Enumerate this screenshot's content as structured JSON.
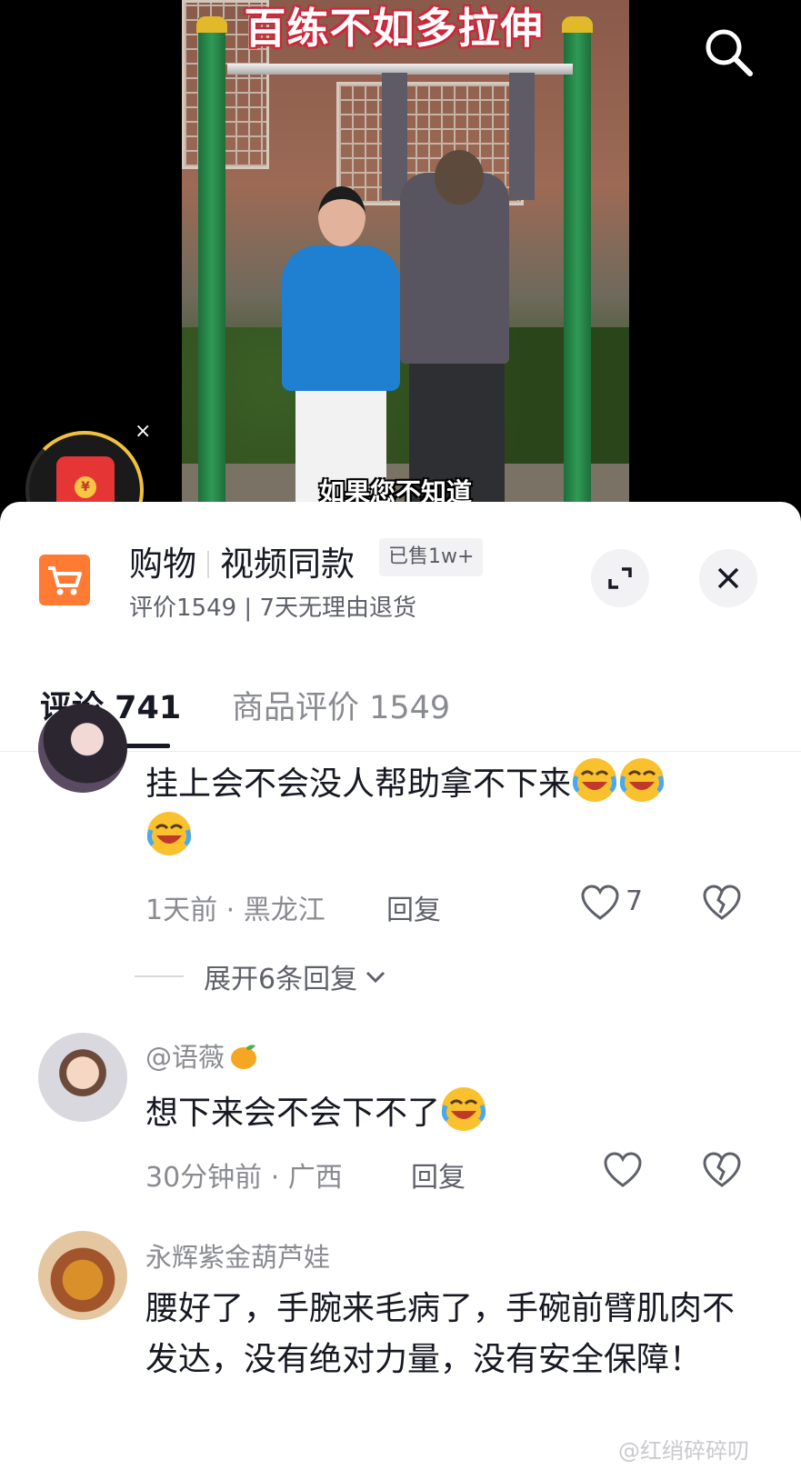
{
  "video": {
    "title_overlay": "百练不如多拉伸",
    "subtitle_overlay": "如果您不知道"
  },
  "redpacket": {
    "close_label": "×"
  },
  "shop": {
    "title_part1": "购物",
    "title_part2": "视频同款",
    "sold_badge": "已售1w+",
    "subtitle": "评价1549 | 7天无理由退货"
  },
  "tabs": [
    {
      "label": "评论 741",
      "active": true
    },
    {
      "label": "商品评价 1549",
      "active": false
    }
  ],
  "comments": [
    {
      "text": "挂上会不会没人帮助拿不下来",
      "meta": "1天前 · 黑龙江",
      "reply_label": "回复",
      "likes": "7",
      "expand_label": "展开6条回复"
    },
    {
      "username": "@语薇",
      "text": "想下来会不会下不了",
      "meta": "30分钟前 · 广西",
      "reply_label": "回复"
    },
    {
      "username": "永辉紫金葫芦娃",
      "text": "腰好了，手腕来毛病了，手碗前臂肌肉不发达，没有绝对力量，没有安全保障！"
    }
  ],
  "watermark": "@红绡碎碎叨",
  "colors": {
    "cart_orange": "#ff7a33",
    "redpacket_red": "#e53535",
    "pole_green": "#2f9a55"
  },
  "icons": [
    "search-icon",
    "redpacket-icon",
    "cart-icon",
    "expand-icon",
    "close-icon",
    "heart-icon",
    "broken-heart-icon",
    "chevron-down-icon",
    "laughing-crying-emoji",
    "mango-emoji"
  ]
}
